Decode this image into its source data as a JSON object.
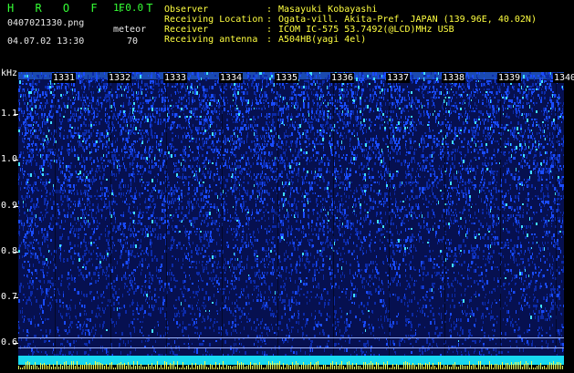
{
  "header": {
    "app_name": "H R O F F T",
    "version": "1.0.0",
    "file_name": "0407021330.png",
    "mode": "meteor",
    "datetime": "04.07.02 13:30",
    "count": "70",
    "fields": [
      {
        "label": "Observer",
        "sep": ":",
        "value": "Masayuki Kobayashi"
      },
      {
        "label": "Receiving Location",
        "sep": ":",
        "value": "Ogata-vill. Akita-Pref. JAPAN (139.96E, 40.02N)"
      },
      {
        "label": "Receiver",
        "sep": ":",
        "value": "ICOM IC-575 53.7492(@LCD)MHz USB"
      },
      {
        "label": "Receiving antenna",
        "sep": ":",
        "value": "A504HB(yagi 4el)"
      }
    ]
  },
  "spectrogram": {
    "y_unit": "kHz",
    "y_ticks": [
      "1.1",
      "1.0",
      "0.9",
      "0.8",
      "0.7",
      "0.6"
    ],
    "time_ticks": [
      "1331",
      "1332",
      "1333",
      "1334",
      "1335",
      "1336",
      "1337",
      "1338",
      "1339",
      "1340"
    ],
    "colors": {
      "background": "#000000",
      "low": "#061050",
      "mid": "#1a4cff",
      "high": "#40e0ff",
      "peak": "#ffff40"
    }
  }
}
